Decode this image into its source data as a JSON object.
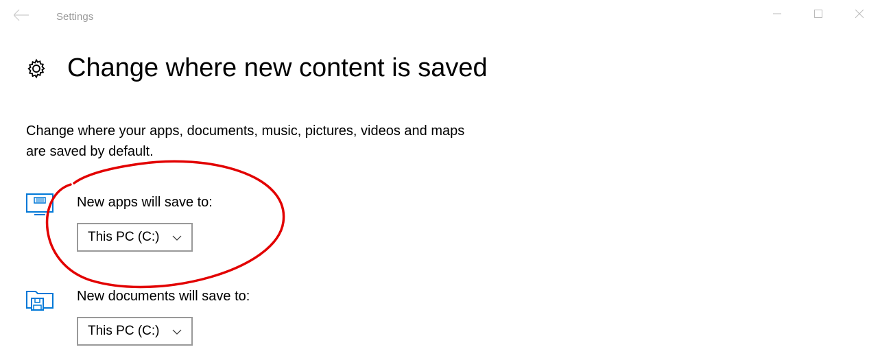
{
  "window": {
    "title": "Settings"
  },
  "page": {
    "title": "Change where new content is saved",
    "description": "Change where your apps, documents, music, pictures, videos and maps are saved by default."
  },
  "settings": {
    "apps": {
      "label": "New apps will save to:",
      "value": "This PC (C:)"
    },
    "documents": {
      "label": "New documents will save to:",
      "value": "This PC (C:)"
    }
  }
}
